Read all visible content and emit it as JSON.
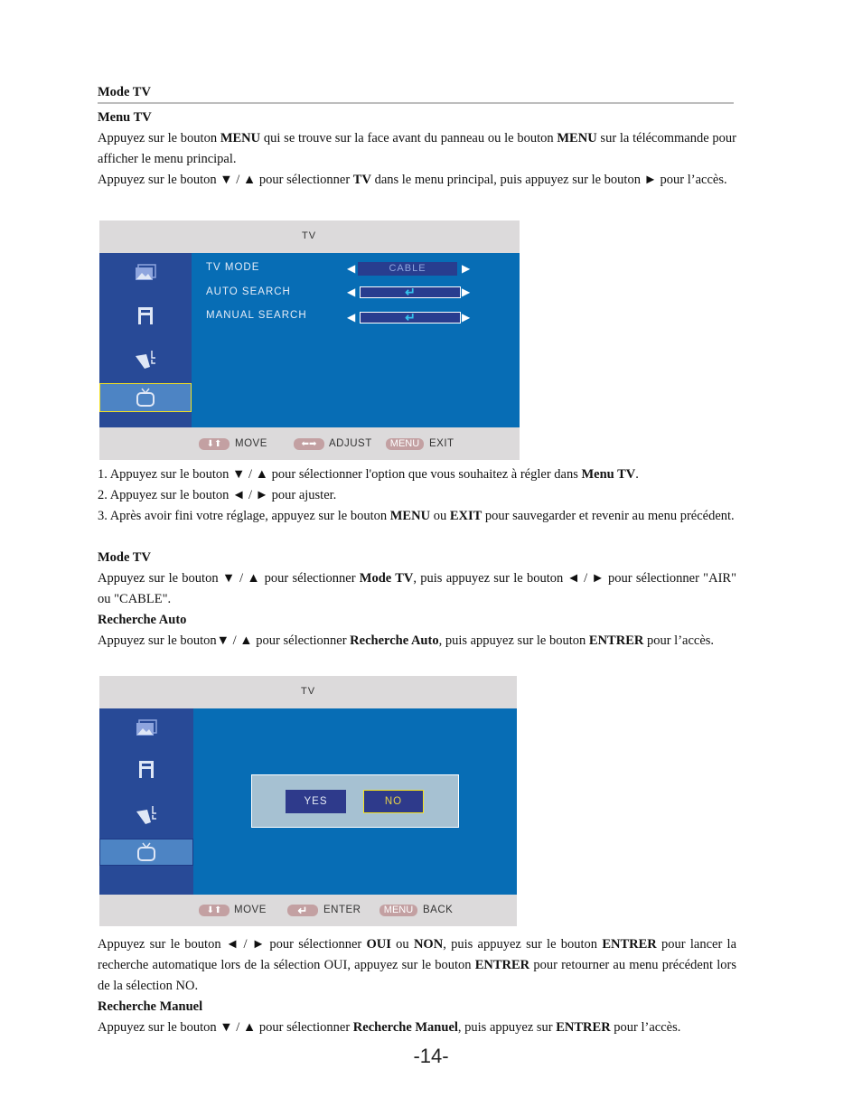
{
  "section_title": "Mode TV",
  "menu_tv": {
    "heading": "Menu TV",
    "p1_a": "Appuyez sur le bouton ",
    "p1_b": "MENU",
    "p1_c": " qui se trouve sur la face avant du panneau ou le bouton ",
    "p1_d": "MENU",
    "p1_e": " sur la télécommande pour afficher le menu principal.",
    "p2_a": "Appuyez sur le bouton ▼ / ▲ pour sélectionner ",
    "p2_b": "TV",
    "p2_c": " dans le menu principal, puis appuyez sur le bouton ► pour l’accès."
  },
  "osd1": {
    "title": "TV",
    "items": [
      {
        "label": "TV MODE",
        "value": "CABLE"
      },
      {
        "label": "AUTO SEARCH",
        "value": "↵"
      },
      {
        "label": "MANUAL SEARCH",
        "value": "↵"
      }
    ],
    "footer": [
      {
        "key": "⬇⬆",
        "label": "MOVE"
      },
      {
        "key": "⬅➡",
        "label": "ADJUST"
      },
      {
        "key": "MENU",
        "label": "EXIT"
      }
    ]
  },
  "steps": {
    "s1_a": "1. Appuyez sur le bouton ▼ / ▲ pour sélectionner l'option que vous souhaitez à régler dans ",
    "s1_b": "Menu TV",
    "s1_c": ".",
    "s2": "2. Appuyez sur le bouton ◄ / ► pour ajuster.",
    "s3_a": "3. Après avoir fini votre réglage, appuyez sur le bouton ",
    "s3_b": "MENU",
    "s3_c": " ou ",
    "s3_d": "EXIT",
    "s3_e": " pour sauvegarder et revenir au menu précédent."
  },
  "mode_tv": {
    "heading": "Mode TV",
    "p_a": "Appuyez sur le bouton ▼ / ▲ pour sélectionner ",
    "p_b": "Mode TV",
    "p_c": ", puis appuyez sur le bouton ◄ / ► pour sélectionner \"AIR\" ou \"CABLE\"."
  },
  "recherche_auto": {
    "heading": "Recherche Auto",
    "p_a": "Appuyez sur le bouton▼ / ▲ pour sélectionner ",
    "p_b": "Recherche Auto",
    "p_c": ", puis appuyez sur le bouton ",
    "p_d": "ENTRER",
    "p_e": " pour l’accès."
  },
  "osd2": {
    "title": "TV",
    "yes": "YES",
    "no": "NO",
    "footer": [
      {
        "key": "↵",
        "label": "ENTER"
      },
      {
        "key": "⬇⬆",
        "label": "MOVE"
      },
      {
        "key": "MENU",
        "label": "BACK"
      }
    ]
  },
  "after_dialog": {
    "p_a": "Appuyez sur le bouton ◄ / ► pour sélectionner ",
    "p_b": "OUI",
    "p_c": " ou ",
    "p_d": "NON",
    "p_e": ", puis appuyez sur le bouton ",
    "p_f": "ENTRER",
    "p_g": " pour lancer la recherche automatique lors de la sélection OUI, appuyez sur le bouton ",
    "p_h": "ENTRER",
    "p_i": " pour retourner au menu précédent lors de la sélection NO."
  },
  "recherche_manuel": {
    "heading": "Recherche Manuel",
    "p_a": "Appuyez sur le bouton ▼ / ▲ pour sélectionner ",
    "p_b": "Recherche Manuel",
    "p_c": ", puis appuyez sur ",
    "p_d": "ENTRER",
    "p_e": " pour l’accès."
  },
  "page_number": "-14-"
}
